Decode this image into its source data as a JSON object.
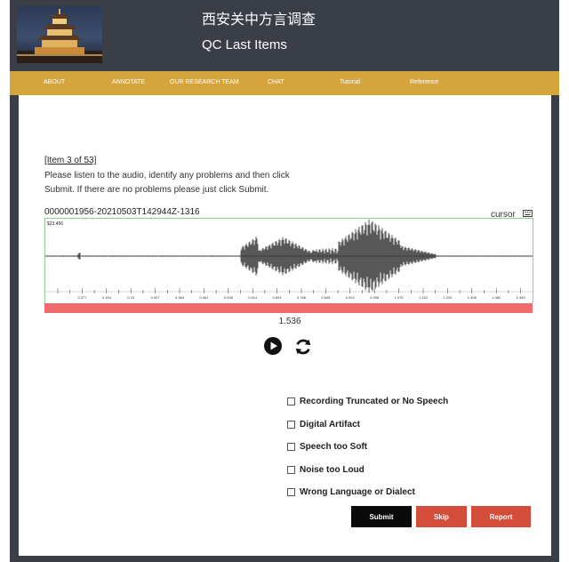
{
  "header": {
    "site_title": "西安关中方言调查",
    "page_title": "QC Last Items"
  },
  "nav": {
    "items": [
      {
        "label": "ABOUT"
      },
      {
        "label": "ANNOTATE"
      },
      {
        "label": "OUR RESEARCH TEAM"
      },
      {
        "label": "CHAT"
      },
      {
        "label": "Tutorial"
      },
      {
        "label": "Reference"
      }
    ]
  },
  "task": {
    "item_link": "[Item 3 of 53]",
    "instructions": "Please listen to the audio, identify any problems and then click Submit. If there are no problems please just click Submit.",
    "file_id": "0000001956-20210503T142944Z-1316"
  },
  "waveform": {
    "cursor_label": "cursor",
    "top_value": "$23.456",
    "ticks": [
      "0.077",
      "0.154",
      "0.23",
      "0.307",
      "0.384",
      "0.461",
      "0.538",
      "0.614",
      "0.691",
      "0.768",
      "0.845",
      "0.922",
      "0.998",
      "1.075",
      "1.152",
      "1.229",
      "1.306",
      "1.382",
      "1.459"
    ],
    "time_readout": "1.536"
  },
  "options": [
    {
      "label": "Recording Truncated or No Speech",
      "checked": false
    },
    {
      "label": "Digital Artifact",
      "checked": false
    },
    {
      "label": "Speech too Soft",
      "checked": false
    },
    {
      "label": "Noise too Loud",
      "checked": false
    },
    {
      "label": "Wrong Language or Dialect",
      "checked": false
    }
  ],
  "buttons": {
    "submit": "Submit",
    "skip": "Skip",
    "report": "Report"
  },
  "colors": {
    "frame": "#3a3e47",
    "nav": "#d4a53c",
    "danger": "#d44c3a",
    "waveform_border": "#8fd08f",
    "red_bar": "#f06b6b"
  }
}
